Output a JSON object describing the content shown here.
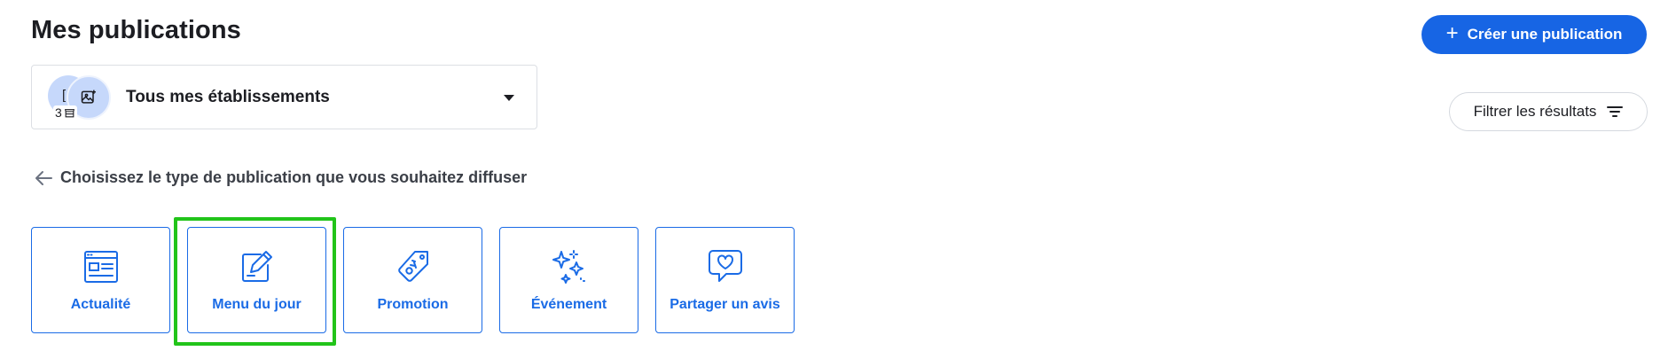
{
  "page": {
    "title": "Mes publications"
  },
  "header": {
    "create_label": "Créer une publication",
    "create_icon": "plus-icon"
  },
  "establishments": {
    "label": "Tous mes établissements",
    "count": "3",
    "count_icon": "store-icon"
  },
  "filter": {
    "label": "Filtrer les résultats",
    "icon": "filter-lines-icon"
  },
  "section": {
    "back_icon": "arrow-left-icon",
    "prompt": "Choisissez le type de publication que vous souhaitez diffuser"
  },
  "types": [
    {
      "label": "Actualité",
      "icon": "news-icon"
    },
    {
      "label": "Menu du jour",
      "icon": "edit-note-icon",
      "highlighted": true
    },
    {
      "label": "Promotion",
      "icon": "tag-percent-icon"
    },
    {
      "label": "Événement",
      "icon": "sparkles-icon"
    },
    {
      "label": "Partager un avis",
      "icon": "heart-bubble-icon"
    }
  ],
  "colors": {
    "primary": "#1765e4",
    "card_border": "#1a6be6",
    "highlight": "#22c41a",
    "avatar_bg": "#c6d8fb"
  }
}
